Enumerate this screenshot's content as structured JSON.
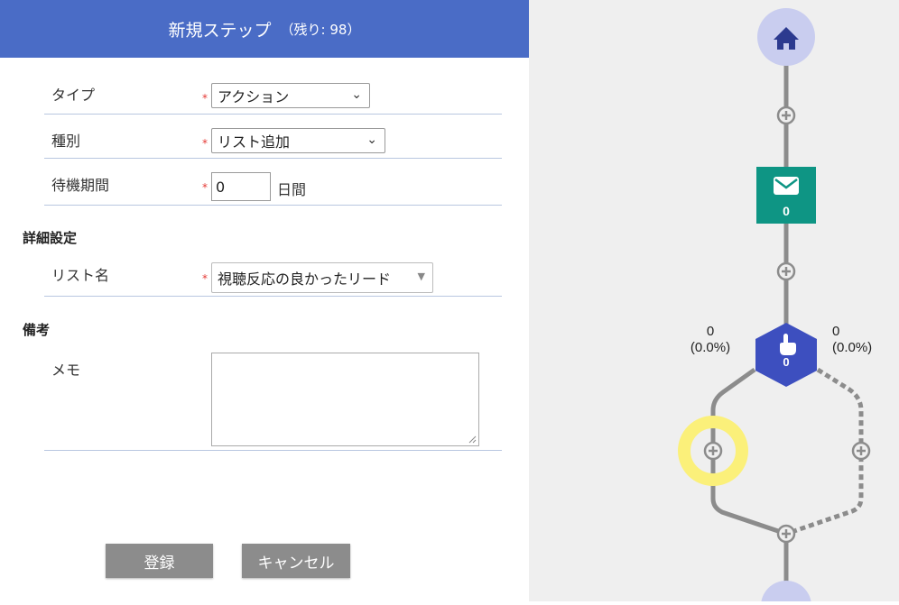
{
  "panel": {
    "title": "新規ステップ",
    "remaining": "（残り: 98）",
    "type_label": "タイプ",
    "type_value": "アクション",
    "kind_label": "種別",
    "kind_value": "リスト追加",
    "wait_label": "待機期間",
    "wait_value": "0",
    "wait_unit": "日間",
    "detail_heading": "詳細設定",
    "list_name_label": "リスト名",
    "list_name_value": "視聴反応の良かったリード",
    "notes_heading": "備考",
    "memo_label": "メモ",
    "memo_value": "",
    "required_mark": "*",
    "submit_label": "登録",
    "cancel_label": "キャンセル"
  },
  "flow": {
    "mail_count": "0",
    "action_count": "0",
    "left_branch_count": "0",
    "left_branch_pct": "(0.0%)",
    "right_branch_count": "0",
    "right_branch_pct": "(0.0%)",
    "colors": {
      "home": "#c9cdef",
      "home_icon": "#2c3a8f",
      "mail": "#0e9584",
      "action": "#3d4fbf",
      "highlight": "#fbf07a",
      "line": "#8c8c8c"
    }
  }
}
